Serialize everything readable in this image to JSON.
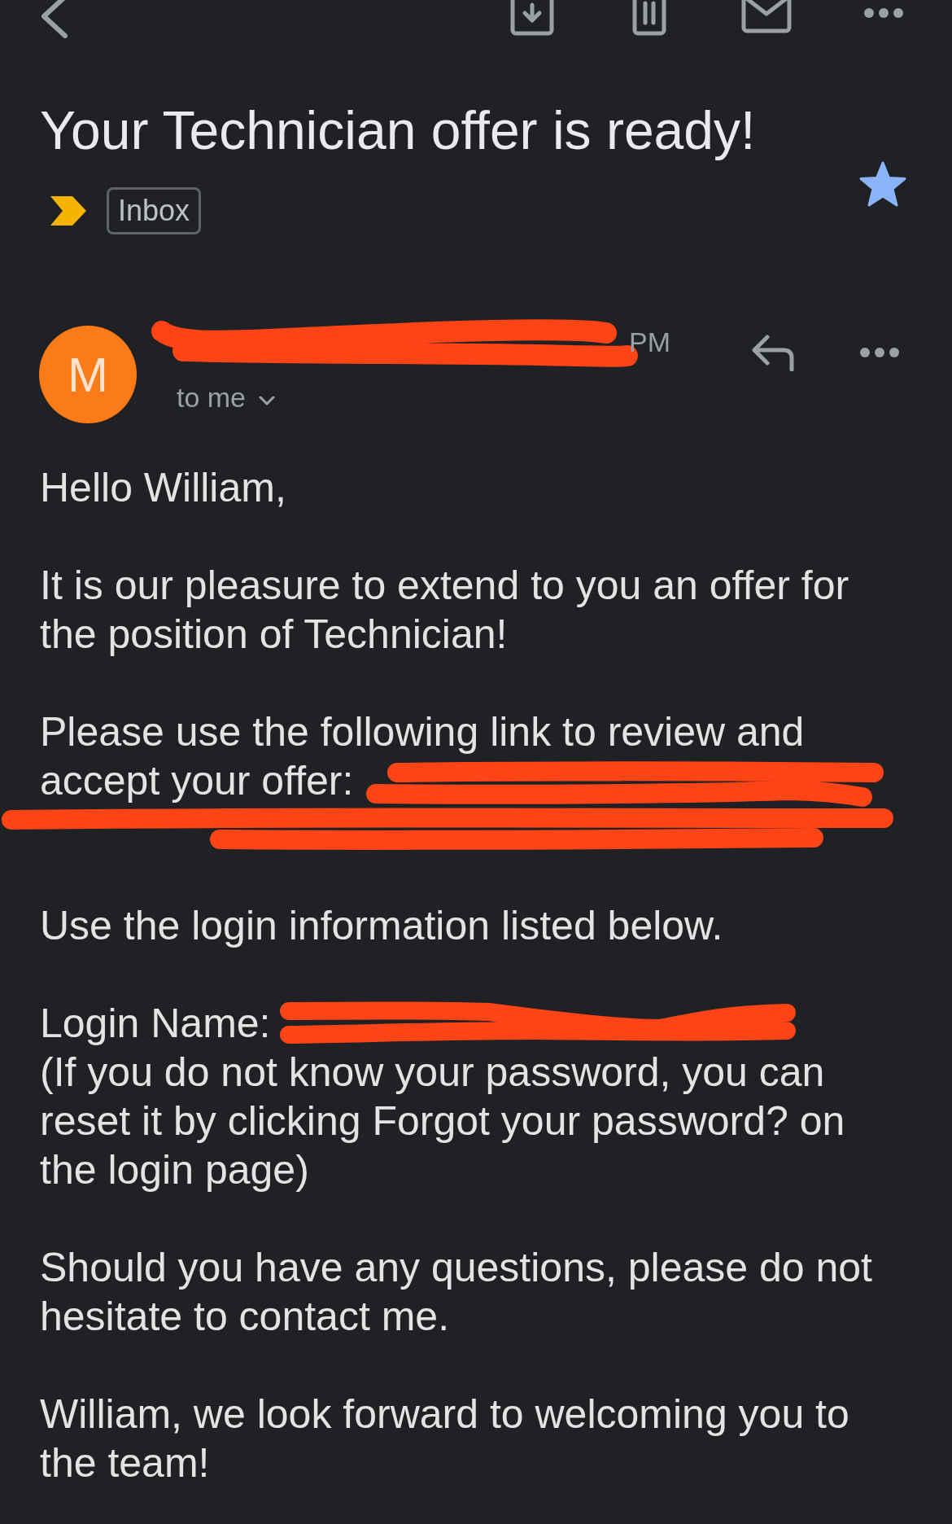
{
  "subject": "Your Technician offer is ready!",
  "labels": {
    "important": true,
    "chips": [
      "Inbox"
    ]
  },
  "starred": true,
  "message": {
    "avatar_letter": "M",
    "time": "PM",
    "recipient": "to me"
  },
  "body": [
    {
      "kind": "text",
      "text": "Hello William,"
    },
    {
      "kind": "text",
      "text": "It is our pleasure to extend to you an offer for the position of Technician!"
    },
    {
      "kind": "link",
      "lines": [
        "Please use the following link to review and",
        "accept your offer:"
      ]
    },
    {
      "kind": "text",
      "text": "Use the login information listed below."
    },
    {
      "kind": "login",
      "label": "Login Name:",
      "note": "(If you do not know your password, you can reset it by clicking Forgot your password? on the login page)"
    },
    {
      "kind": "text",
      "text": "Should you have any questions, please do not hesitate to contact me."
    },
    {
      "kind": "text",
      "text": "William, we look forward to welcoming you to the team!"
    }
  ]
}
